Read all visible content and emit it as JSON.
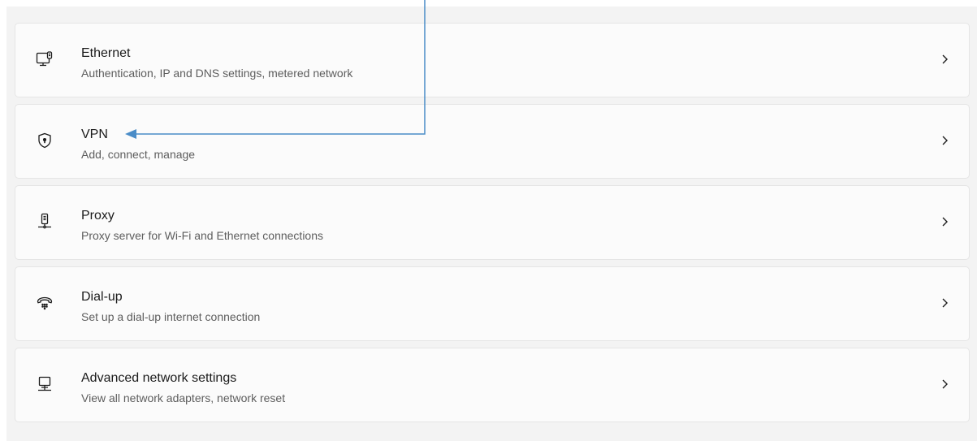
{
  "colors": {
    "panel_bg": "#f3f3f3",
    "card_bg": "#fbfbfb",
    "card_border": "#e5e5e5",
    "title": "#1b1b1b",
    "subtitle": "#5d5d5d",
    "annotation_arrow": "#4a8cc7"
  },
  "items": [
    {
      "key": "ethernet",
      "icon": "ethernet-icon",
      "title": "Ethernet",
      "subtitle": "Authentication, IP and DNS settings, metered network"
    },
    {
      "key": "vpn",
      "icon": "vpn-shield-icon",
      "title": "VPN",
      "subtitle": "Add, connect, manage"
    },
    {
      "key": "proxy",
      "icon": "proxy-icon",
      "title": "Proxy",
      "subtitle": "Proxy server for Wi-Fi and Ethernet connections"
    },
    {
      "key": "dialup",
      "icon": "dial-up-phone-icon",
      "title": "Dial-up",
      "subtitle": "Set up a dial-up internet connection"
    },
    {
      "key": "advanced",
      "icon": "advanced-network-icon",
      "title": "Advanced network settings",
      "subtitle": "View all network adapters, network reset"
    }
  ],
  "annotation": {
    "icon": "arrow-pointer",
    "target": "vpn"
  }
}
